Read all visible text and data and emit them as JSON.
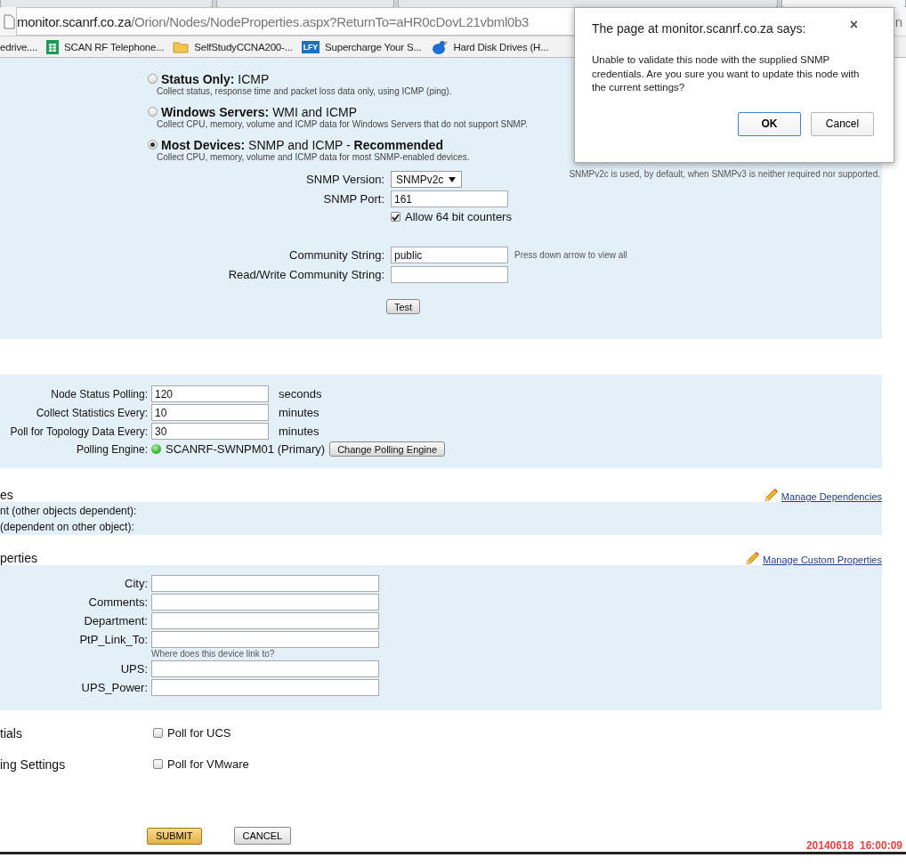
{
  "browser": {
    "tabs": [
      {
        "selected": false
      },
      {
        "selected": false
      },
      {
        "selected": false
      },
      {
        "selected": true
      }
    ],
    "url_host": "monitor.scanrf.co.za",
    "url_path": "/Orion/Nodes/NodeProperties.aspx?ReturnTo=aHR0cDovL21vbml0b3",
    "url_tail": "n",
    "bookmarks": [
      {
        "kind": "plain",
        "label": "edrive...."
      },
      {
        "kind": "sheet",
        "label": "SCAN RF Telephone..."
      },
      {
        "kind": "folder",
        "label": "SelfStudyCCNA200-..."
      },
      {
        "kind": "badge",
        "badge": "LFY",
        "label": "Supercharge Your S..."
      },
      {
        "kind": "bird",
        "label": "Hard Disk Drives (H..."
      }
    ]
  },
  "polling_method": {
    "options": [
      {
        "title": "Status Only:",
        "detail": "ICMP",
        "description": "Collect status, response time and packet loss data only, using ICMP (ping).",
        "selected": false
      },
      {
        "title": "Windows Servers:",
        "detail": "WMI and ICMP",
        "description": "Collect CPU, memory, volume and ICMP data for Windows Servers that do not support SNMP.",
        "selected": false
      },
      {
        "title": "Most Devices:",
        "detail": "SNMP and ICMP - **Recommended**",
        "description": "Collect CPU, memory, volume and ICMP data for most SNMP-enabled devices.",
        "selected": true
      }
    ]
  },
  "snmp": {
    "version_label": "SNMP Version:",
    "version": "SNMPv2c",
    "version_note": "SNMPv2c is used, by default, when SNMPv3 is neither required nor supported.",
    "port_label": "SNMP Port:",
    "port": "161",
    "counters": {
      "label": "Allow 64 bit counters",
      "checked": true
    },
    "community_label": "Community String:",
    "community": "public",
    "community_hint": "Press down arrow to view all",
    "rw_label": "Read/Write Community String:",
    "test_button": "Test"
  },
  "polling": {
    "rows": [
      {
        "label": "Node Status Polling:",
        "value": "120",
        "unit": "seconds"
      },
      {
        "label": "Collect Statistics Every:",
        "value": "10",
        "unit": "minutes"
      },
      {
        "label": "Poll for Topology Data Every:",
        "value": "30",
        "unit": "minutes"
      }
    ],
    "engine_label": "Polling Engine:",
    "engine": "SCANRF-SWNPM01 (Primary)",
    "engine_button": "Change Polling Engine"
  },
  "dependencies": {
    "heading": "es",
    "link": "Manage Dependencies",
    "rows": [
      "nt (other objects dependent):",
      "(dependent on other object):"
    ]
  },
  "custom_properties": {
    "heading": "perties",
    "link": "Manage Custom Properties",
    "fields": [
      {
        "label": "City:"
      },
      {
        "label": "Comments:"
      },
      {
        "label": "Department:"
      },
      {
        "label": "PtP_Link_To:",
        "hint": "Where does this device link to?"
      },
      {
        "label": "UPS:"
      },
      {
        "label": "UPS_Power:"
      }
    ]
  },
  "extras": [
    {
      "heading": "tials",
      "label": "Poll for UCS",
      "checked": false
    },
    {
      "heading": "ing Settings",
      "label": "Poll for VMware",
      "checked": false
    }
  ],
  "buttons": {
    "submit": "SUBMIT",
    "cancel": "CANCEL"
  },
  "dialog": {
    "title": "The page at monitor.scanrf.co.za says:",
    "close": "×",
    "message": "Unable to validate this node with the supplied SNMP credentials. Are you sure you want to update this node with the current settings?",
    "ok": "OK",
    "cancel": "Cancel"
  },
  "timestamp": "20140618  16:00:09"
}
